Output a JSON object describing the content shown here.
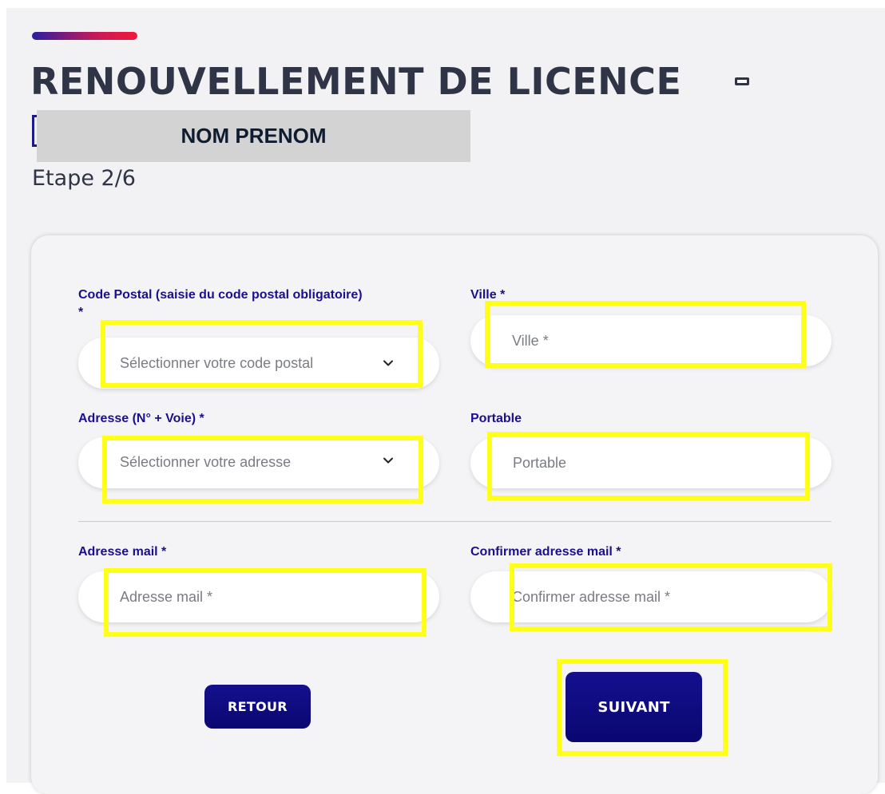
{
  "header": {
    "title": "RENOUVELLEMENT DE LICENCE -",
    "name_redaction": "NOM PRENOM",
    "step": "Etape 2/6"
  },
  "form": {
    "code_postal": {
      "label_line1": "Code Postal (saisie du code postal obligatoire)",
      "label_line2": "*",
      "placeholder": "Sélectionner votre code postal",
      "icon": "chevron-down-icon"
    },
    "ville": {
      "label": "Ville *",
      "placeholder": "Ville *"
    },
    "adresse": {
      "label": "Adresse (N° + Voie) *",
      "placeholder": "Sélectionner votre adresse",
      "icon": "chevron-down-icon"
    },
    "portable": {
      "label": "Portable",
      "placeholder": "Portable"
    },
    "email": {
      "label": "Adresse mail *",
      "placeholder": "Adresse mail *"
    },
    "email_confirm": {
      "label": "Confirmer adresse mail *",
      "placeholder": "Confirmer adresse mail *"
    }
  },
  "buttons": {
    "back": "RETOUR",
    "next": "SUIVANT"
  },
  "colors": {
    "label": "#1a0f8f",
    "button": "#0a0771",
    "highlight": "#ffff1a",
    "title": "#2f3447"
  }
}
